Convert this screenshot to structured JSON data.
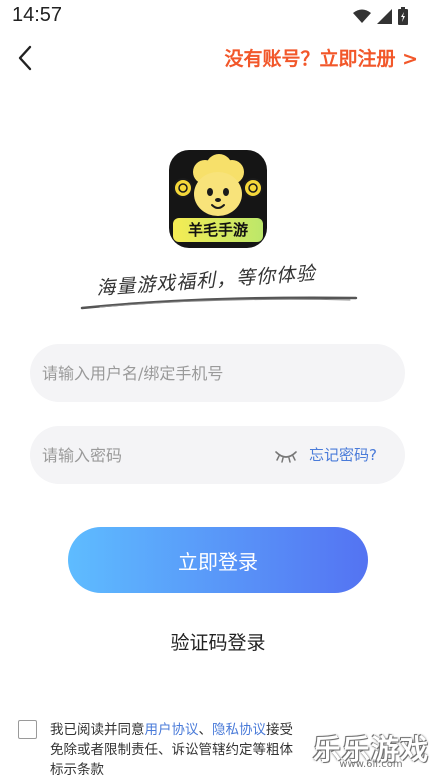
{
  "status_bar": {
    "time": "14:57"
  },
  "header": {
    "register": "没有账号？立即注册 >"
  },
  "logo": {
    "text": "羊毛手游"
  },
  "slogan": "海量游戏福利，等你体验",
  "form": {
    "username_placeholder": "请输入用户名/绑定手机号",
    "password_placeholder": "请输入密码",
    "forgot": "忘记密码?",
    "login": "立即登录",
    "sms_login": "验证码登录"
  },
  "agreement": {
    "prefix": "我已阅读并同意",
    "user_agreement": "用户协议",
    "separator": "、",
    "privacy": "隐私协议",
    "suffix": "接受免除或者限制责任、诉讼管辖约定等粗体标示条款"
  },
  "watermark": {
    "text": "乐乐游戏",
    "url": "www.6ll.com"
  },
  "colors": {
    "accent": "#f2572a",
    "link": "#4a7bd9",
    "button_start": "#5ebcff",
    "button_end": "#5473f2"
  }
}
